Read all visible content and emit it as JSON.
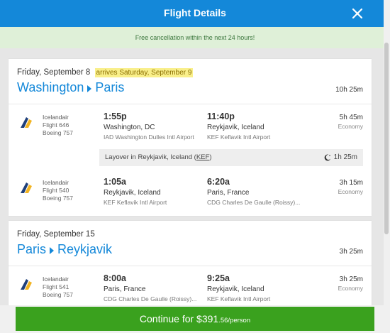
{
  "header": {
    "title": "Flight Details"
  },
  "notice": "Free cancellation within the next 24 hours!",
  "legs": [
    {
      "date": "Friday, September 8",
      "arrives": "arrives Saturday, September 9",
      "from": "Washington",
      "to": "Paris",
      "total": "10h 25m",
      "segments": [
        {
          "airline": "Icelandair",
          "flight": "Flight 646",
          "aircraft": "Boeing 757",
          "dep_time": "1:55p",
          "dep_city": "Washington, DC",
          "dep_airport": "IAD Washington Dulles Intl Airport",
          "arr_time": "11:40p",
          "arr_city": "Reykjavik, Iceland",
          "arr_airport": "KEF Keflavik Intl Airport",
          "duration": "5h 45m",
          "cabin": "Economy"
        },
        {
          "airline": "Icelandair",
          "flight": "Flight 540",
          "aircraft": "Boeing 757",
          "dep_time": "1:05a",
          "dep_city": "Reykjavik, Iceland",
          "dep_airport": "KEF Keflavik Intl Airport",
          "arr_time": "6:20a",
          "arr_city": "Paris, France",
          "arr_airport": "CDG Charles De Gaulle (Roissy)...",
          "duration": "3h 15m",
          "cabin": "Economy"
        }
      ],
      "layover": {
        "text": "Layover in Reykjavik, Iceland (",
        "code": "KEF",
        "close": ")",
        "duration": "1h 25m"
      }
    },
    {
      "date": "Friday, September 15",
      "from": "Paris",
      "to": "Reykjavik",
      "total": "3h 25m",
      "segments": [
        {
          "airline": "Icelandair",
          "flight": "Flight 541",
          "aircraft": "Boeing 757",
          "dep_time": "8:00a",
          "dep_city": "Paris, France",
          "dep_airport": "CDG Charles De Gaulle (Roissy)...",
          "arr_time": "9:25a",
          "arr_city": "Reykjavik, Iceland",
          "arr_airport": "KEF Keflavik Intl Airport",
          "duration": "3h 25m",
          "cabin": "Economy"
        }
      ]
    }
  ],
  "cta": {
    "label": "Continue for $391",
    "cents": ".56/person"
  },
  "icons": {
    "close": "close-icon",
    "airline_logo": "icelandair-logo-icon",
    "layover": "moon-icon"
  },
  "colors": {
    "header": "#1488d9",
    "notice_bg": "#dff0d8",
    "notice_text": "#3c763d",
    "cta": "#3aa11e",
    "link": "#1488d9",
    "highlight": "#f9ef8a"
  }
}
